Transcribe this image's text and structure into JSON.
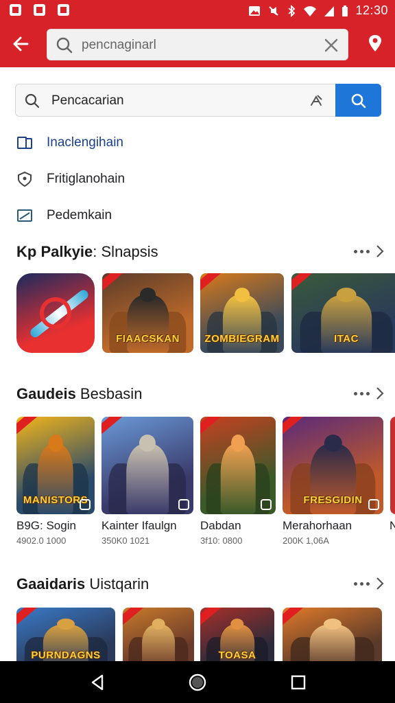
{
  "status_bar": {
    "time": "12:30"
  },
  "top_search": {
    "value": "pencnaginarl",
    "placeholder": "pencnaginarl"
  },
  "search_bar": {
    "value": "Pencacarian"
  },
  "suggestions": [
    {
      "label": "Inaclengihain",
      "icon": "devices-icon"
    },
    {
      "label": "Fritiglanohain",
      "icon": "shield-icon"
    },
    {
      "label": "Pedemkain",
      "icon": "display-icon"
    }
  ],
  "sections": [
    {
      "title_bold": "Kp Palkyie",
      "title_light": ": Slnapsis",
      "tiles": [
        {
          "title": "",
          "colors": [
            "#1b2a5e",
            "#e83030",
            "#2fa7d8"
          ]
        },
        {
          "title": "FIAACSKAN",
          "colors": [
            "#5a3c2a",
            "#c06a2a",
            "#2a2a2a"
          ]
        },
        {
          "title": "ZOMBIEGRAM",
          "colors": [
            "#d97a1a",
            "#3b4a5a",
            "#f2c040"
          ]
        },
        {
          "title": "ITAC",
          "colors": [
            "#3a5a3a",
            "#2a3a5a",
            "#c8a040"
          ]
        }
      ]
    },
    {
      "title_bold": "Gaudeis",
      "title_light": " Besbasin",
      "tiles": [
        {
          "title": "MANISTORS",
          "name": "B9G: Sogin",
          "meta": "4902.0 1000",
          "colors": [
            "#f2b51a",
            "#2a4a6a",
            "#d87a1a"
          ]
        },
        {
          "title": "",
          "name": "Kainter Ifaulgn",
          "meta": "350K0 1021",
          "colors": [
            "#6a9ad8",
            "#3a3a6a",
            "#c8c0b0"
          ]
        },
        {
          "title": "",
          "name": "Dabdan",
          "meta": "3f10: 0800",
          "colors": [
            "#c84020",
            "#3a5a2a",
            "#f0a050"
          ]
        },
        {
          "title": "FRESGIDIN",
          "name": "Merahorhaan",
          "meta": "200K 1,06A",
          "colors": [
            "#5a2a7a",
            "#c05a2a",
            "#2a2a4a"
          ]
        }
      ],
      "partial_name": "N"
    },
    {
      "title_bold": "Gaaidaris",
      "title_light": " Uistqarin",
      "tiles": [
        {
          "title": "PURNDAGNS",
          "colors": [
            "#3a7ac8",
            "#2a3a5a",
            "#d8a040"
          ]
        },
        {
          "title": "",
          "colors": [
            "#c87a2a",
            "#6a3a2a",
            "#e0b060"
          ]
        },
        {
          "title": "TOASA",
          "colors": [
            "#a8302a",
            "#2a2a3a",
            "#e09040"
          ]
        },
        {
          "title": "",
          "colors": [
            "#e07a2a",
            "#5a3a2a",
            "#f0c080"
          ]
        }
      ]
    }
  ],
  "nav": {
    "back": "back-icon",
    "home": "home-icon",
    "recents": "recents-icon"
  }
}
